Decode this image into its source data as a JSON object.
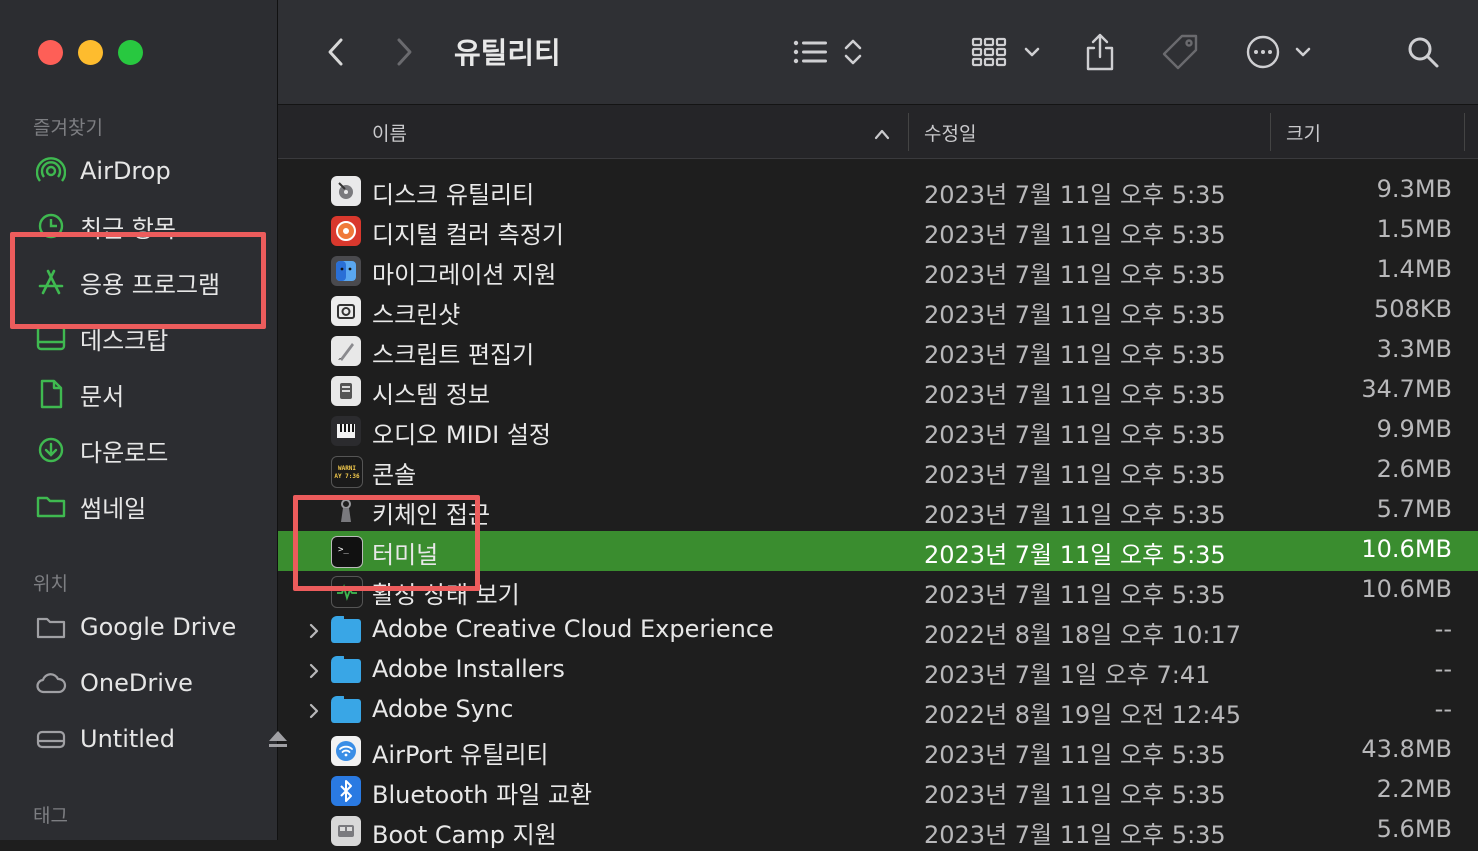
{
  "window": {
    "title": "유틸리티"
  },
  "sidebar": {
    "favorites_label": "즐겨찾기",
    "favorites": [
      {
        "label": "AirDrop",
        "icon": "airdrop-icon"
      },
      {
        "label": "최근 항목",
        "icon": "clock-icon"
      },
      {
        "label": "응용 프로그램",
        "icon": "applications-icon"
      },
      {
        "label": "데스크탑",
        "icon": "desktop-icon"
      },
      {
        "label": "문서",
        "icon": "document-icon"
      },
      {
        "label": "다운로드",
        "icon": "download-icon"
      },
      {
        "label": "썸네일",
        "icon": "folder-icon"
      }
    ],
    "locations_label": "위치",
    "locations": [
      {
        "label": "Google Drive",
        "icon": "folder-icon"
      },
      {
        "label": "OneDrive",
        "icon": "cloud-icon"
      },
      {
        "label": "Untitled",
        "icon": "drive-icon"
      }
    ],
    "tags_label": "태그"
  },
  "columns": {
    "name": "이름",
    "modified": "수정일",
    "size": "크기"
  },
  "files": [
    {
      "name": "디스크 유틸리티",
      "date": "2023년 7월 11일 오후 5:35",
      "size": "9.3MB",
      "icon": "disk-utility-icon"
    },
    {
      "name": "디지털 컬러 측정기",
      "date": "2023년 7월 11일 오후 5:35",
      "size": "1.5MB",
      "icon": "color-meter-icon"
    },
    {
      "name": "마이그레이션 지원",
      "date": "2023년 7월 11일 오후 5:35",
      "size": "1.4MB",
      "icon": "migration-icon"
    },
    {
      "name": "스크린샷",
      "date": "2023년 7월 11일 오후 5:35",
      "size": "508KB",
      "icon": "screenshot-icon"
    },
    {
      "name": "스크립트 편집기",
      "date": "2023년 7월 11일 오후 5:35",
      "size": "3.3MB",
      "icon": "script-editor-icon"
    },
    {
      "name": "시스템 정보",
      "date": "2023년 7월 11일 오후 5:35",
      "size": "34.7MB",
      "icon": "system-info-icon"
    },
    {
      "name": "오디오 MIDI 설정",
      "date": "2023년 7월 11일 오후 5:35",
      "size": "9.9MB",
      "icon": "midi-icon"
    },
    {
      "name": "콘솔",
      "date": "2023년 7월 11일 오후 5:35",
      "size": "2.6MB",
      "icon": "console-icon",
      "icon_text": "WARNI\nAY 7:36"
    },
    {
      "name": "키체인 접근",
      "date": "2023년 7월 11일 오후 5:35",
      "size": "5.7MB",
      "icon": "keychain-icon"
    },
    {
      "name": "터미널",
      "date": "2023년 7월 11일 오후 5:35",
      "size": "10.6MB",
      "icon": "terminal-icon",
      "selected": true
    },
    {
      "name": "활성 상태 보기",
      "date": "2023년 7월 11일 오후 5:35",
      "size": "10.6MB",
      "icon": "activity-monitor-icon"
    },
    {
      "name": "Adobe Creative Cloud Experience",
      "date": "2022년 8월 18일 오후 10:17",
      "size": "--",
      "icon": "folder-icon",
      "folder": true
    },
    {
      "name": "Adobe Installers",
      "date": "2023년 7월 1일 오후 7:41",
      "size": "--",
      "icon": "folder-icon",
      "folder": true
    },
    {
      "name": "Adobe Sync",
      "date": "2022년 8월 19일 오전 12:45",
      "size": "--",
      "icon": "folder-icon",
      "folder": true
    },
    {
      "name": "AirPort 유틸리티",
      "date": "2023년 7월 11일 오후 5:35",
      "size": "43.8MB",
      "icon": "airport-icon"
    },
    {
      "name": "Bluetooth 파일 교환",
      "date": "2023년 7월 11일 오후 5:35",
      "size": "2.2MB",
      "icon": "bluetooth-icon"
    },
    {
      "name": "Boot Camp 지원",
      "date": "2023년 7월 11일 오후 5:35",
      "size": "5.6MB",
      "icon": "bootcamp-icon"
    }
  ],
  "colors": {
    "accent": "#3a8d2f",
    "highlight_box": "#ec5c5c"
  }
}
